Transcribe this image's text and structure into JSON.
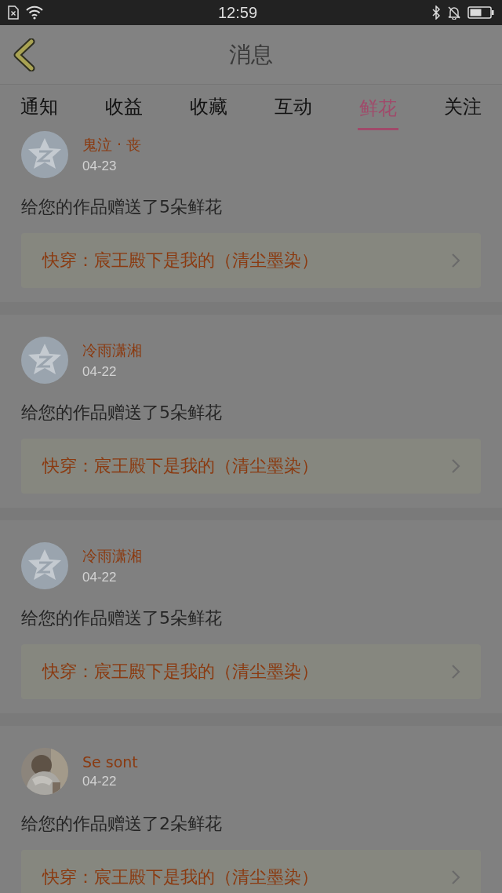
{
  "status_bar": {
    "time": "12:59"
  },
  "header": {
    "title": "消息"
  },
  "tabs": [
    {
      "label": "通知",
      "selected": false
    },
    {
      "label": "收益",
      "selected": false
    },
    {
      "label": "收藏",
      "selected": false
    },
    {
      "label": "互动",
      "selected": false
    },
    {
      "label": "鲜花",
      "selected": true
    },
    {
      "label": "关注",
      "selected": false
    }
  ],
  "messages": [
    {
      "name": "鬼泣 · 丧",
      "date": "04-23",
      "text": "给您的作品赠送了5朵鲜花",
      "book": "快穿：宸王殿下是我的（清尘墨染）",
      "kind": "default"
    },
    {
      "name": "冷雨潇湘",
      "date": "04-22",
      "text": "给您的作品赠送了5朵鲜花",
      "book": "快穿：宸王殿下是我的（清尘墨染）",
      "kind": "default"
    },
    {
      "name": "冷雨潇湘",
      "date": "04-22",
      "text": "给您的作品赠送了5朵鲜花",
      "book": "快穿：宸王殿下是我的（清尘墨染）",
      "kind": "default"
    },
    {
      "name": "Se sont",
      "date": "04-22",
      "text": "给您的作品赠送了2朵鲜花",
      "book": "快穿：宸王殿下是我的（清尘墨染）",
      "kind": "picture"
    }
  ]
}
